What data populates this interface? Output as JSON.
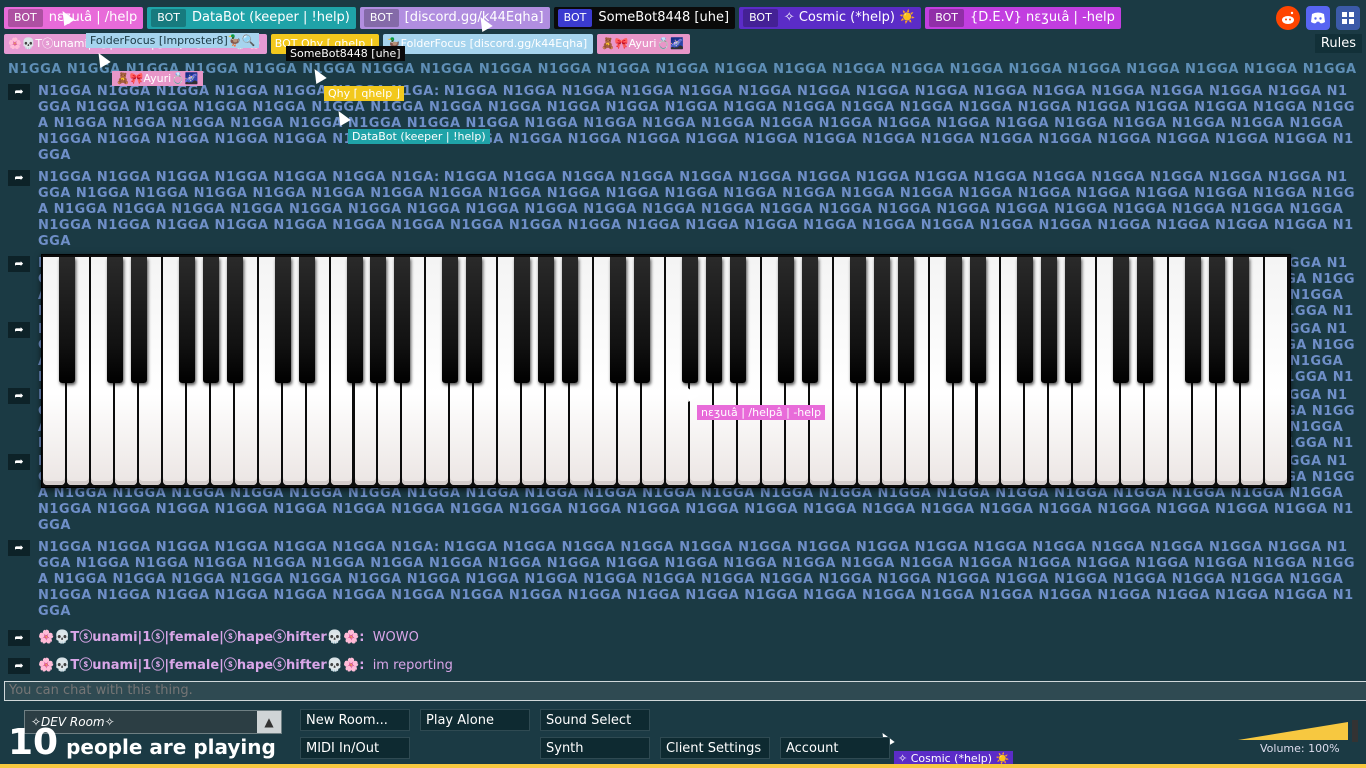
{
  "users_top": [
    {
      "bot": "BOT",
      "name": "nεʒuɩâ | /help",
      "color": "#e86bd9"
    },
    {
      "bot": "BOT",
      "name": "DataBot (keeper | !help)",
      "color": "#1fa3a8"
    },
    {
      "bot": "BOT",
      "name": "[discord.gg/k44Eqha]",
      "color": "#b18ee0"
    },
    {
      "bot": "BOT",
      "name": "SomeBot8448 [uhe]",
      "color": "#0a0a0a"
    },
    {
      "bot": "BOT",
      "name": "✧ Cosmic (*help) ☀️",
      "color": "#5b2cc7"
    },
    {
      "bot": "BOT",
      "name": "{D.E.V} nεʒuɩâ | -help",
      "color": "#c23ee0"
    }
  ],
  "users_second": [
    {
      "name": "🌸💀Tⓢunami|1ⓢ|female|ⓢhapeⓢhifter💀🌸",
      "color": "#e59ad3"
    },
    {
      "name": "BOT  Qhy ⌈ qhelp ⌋",
      "color": "#f2c81d"
    },
    {
      "name": "🦆FolderFocus [discord.gg/k44Eqha]",
      "color": "#a6d4ee"
    },
    {
      "name": "🧸🎀Ayuri💍🌌",
      "color": "#e896c8"
    }
  ],
  "top_icons": [
    "reddit-icon",
    "discord-icon",
    "settings-grid-icon"
  ],
  "rules_label": "Rules",
  "chat": {
    "spam_word": "N1GGA",
    "spam_block_1": "N1GGA N1GGA N1GGA N1GGA N1GGA N1GGA N1GGA N1GGA N1GGA N1GGA N1GGA N1GGA N1GGA N1GGA N1GGA N1GGA N1GGA N1GGA N1GGA N1GGA N1GGA N1GGA N1GGA N1GGA N1GGA N1GGA N1GGA N1GGA N1GGA N1GGA N1GGA N1GGA N1GGA N1GGA N1GGA N1GGA N1GGA N1GGA N1GGA N1GGA N1GGA N1GGA N1GGA N1GGA N1GGA N1GGA N1GGA N1GGA N1GGA N1GGA N1GGA N1GGA N1GGA N1GGA N1GGA N1GGA N1GGA N1GGA N1GGA N1GGA N1GGA N1GGA N1GGA N1GGA N1GGA N1GGA N1GGA N1GGA N1GGA N1GGA N1GGA N1GGA N1GGA N1GGA N1GGA N1GGA N1GGA N1GGA N1GGA",
    "spam_author": "N1GGA N1GGA N1GGA N1GGA N1GGA N1GGA N1GA:",
    "spam_line": "N1GGA N1GGA N1GGA N1GGA N1GGA N1GGA N1GGA N1GGA N1GGA N1GGA N1GGA N1GGA N1GGA N1GGA N1GGA N1GGA N1GGA N1GGA N1GGA N1GGA N1GGA N1GGA N1GGA N1GGA N1GGA N1GGA N1GGA N1GGA N1GGA N1GGA N1GGA N1GGA N1GGA N1GGA N1GGA N1GGA N1GGA N1GGA N1GGA N1GGA N1GGA N1GGA N1GGA N1GGA N1GGA N1GGA N1GGA N1GGA N1GGA N1GGA N1GGA N1GGA N1GGA N1GGA N1GGA N1GGA N1GGA N1GGA N1GGA N1GGA N1GGA N1GGA N1GGA N1GGA N1GGA N1GGA N1GGA N1GGA N1GGA N1GGA N1GGA N1GGA N1GGA N1GGA N1GGA N1GGA N1GGA N1GGA N1GGA N1GGA N1GGA N1GGA N1GGA",
    "messages": [
      {
        "author": "🌸💀Tⓢunami|1ⓢ|female|ⓢhapeⓢhifter💀🌸:",
        "text": "WOWO"
      },
      {
        "author": "🌸💀Tⓢunami|1ⓢ|female|ⓢhapeⓢhifter💀🌸:",
        "text": "im reporting"
      }
    ]
  },
  "cursors": [
    {
      "label": "FolderFocus [Improster8]🦆🔍",
      "color": "#a6d4ee",
      "text_color": "#1b3a44"
    },
    {
      "label": "SomeBot8448 [uhe]",
      "color": "#0a0a0a",
      "text_color": "#ffffff"
    },
    {
      "label": "Qhy ⌈ qhelp ⌋",
      "color": "#f2c81d",
      "text_color": "#ffffff"
    },
    {
      "label": "🧸🎀Ayuri💍🌌",
      "color": "#e896c8",
      "text_color": "#ffffff"
    },
    {
      "label": "DataBot (keeper | !help)",
      "color": "#1fa3a8",
      "text_color": "#ffffff"
    },
    {
      "label": "nεʒuɩâ | /helpâ | -help",
      "color": "#e86bd9",
      "text_color": "#ffffff"
    },
    {
      "label": "✧ Cosmic (*help) ☀️",
      "color": "#5b2cc7",
      "text_color": "#ffffff"
    }
  ],
  "chat_input_placeholder": "You can chat with this thing.",
  "room": {
    "name": "✧𝘋𝘌𝘝 𝘙𝘰𝘰𝘮✧"
  },
  "players": {
    "count": "10",
    "label": "people are playing"
  },
  "buttons": {
    "new_room": "New Room...",
    "play_alone": "Play Alone",
    "sound_select": "Sound Select",
    "midi": "MIDI In/Out",
    "synth": "Synth",
    "client_settings": "Client Settings",
    "account": "Account"
  },
  "volume": {
    "label": "Volume: 100%",
    "level": 1.0
  }
}
